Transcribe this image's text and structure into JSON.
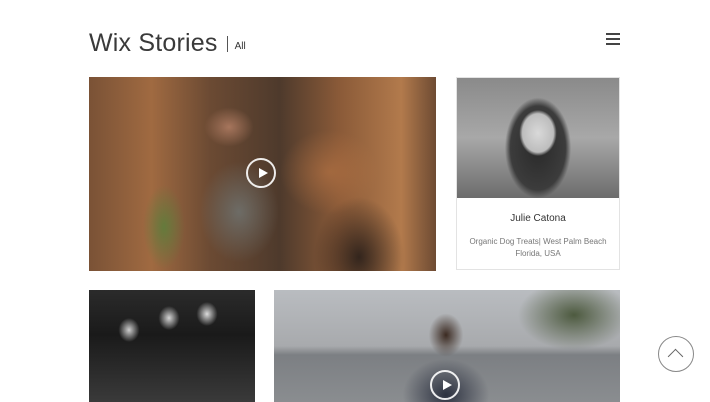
{
  "header": {
    "brand": "Wix Stories",
    "filter": "All"
  },
  "menu": {
    "icon": "hamburger-menu-icon"
  },
  "stories": [
    {
      "id": "barber",
      "type": "video",
      "icon": "play-icon"
    },
    {
      "id": "profile",
      "type": "profile",
      "name": "Julie Catona",
      "description": "Organic Dog Treats| West Palm Beach Florida, USA"
    },
    {
      "id": "band",
      "type": "image"
    },
    {
      "id": "outdoor",
      "type": "video",
      "icon": "play-icon"
    }
  ],
  "scroll_top": {
    "icon": "chevron-up-icon"
  }
}
